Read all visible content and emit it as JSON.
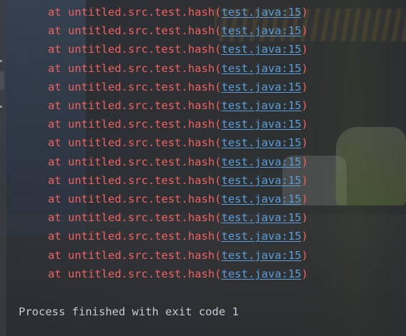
{
  "console": {
    "stack_lines": [
      {
        "prefix": "at untitled.src.test.hash(",
        "link": "test.java:15",
        "suffix": ")"
      },
      {
        "prefix": "at untitled.src.test.hash(",
        "link": "test.java:15",
        "suffix": ")"
      },
      {
        "prefix": "at untitled.src.test.hash(",
        "link": "test.java:15",
        "suffix": ")"
      },
      {
        "prefix": "at untitled.src.test.hash(",
        "link": "test.java:15",
        "suffix": ")"
      },
      {
        "prefix": "at untitled.src.test.hash(",
        "link": "test.java:15",
        "suffix": ")"
      },
      {
        "prefix": "at untitled.src.test.hash(",
        "link": "test.java:15",
        "suffix": ")"
      },
      {
        "prefix": "at untitled.src.test.hash(",
        "link": "test.java:15",
        "suffix": ")"
      },
      {
        "prefix": "at untitled.src.test.hash(",
        "link": "test.java:15",
        "suffix": ")"
      },
      {
        "prefix": "at untitled.src.test.hash(",
        "link": "test.java:15",
        "suffix": ")"
      },
      {
        "prefix": "at untitled.src.test.hash(",
        "link": "test.java:15",
        "suffix": ")"
      },
      {
        "prefix": "at untitled.src.test.hash(",
        "link": "test.java:15",
        "suffix": ")"
      },
      {
        "prefix": "at untitled.src.test.hash(",
        "link": "test.java:15",
        "suffix": ")"
      },
      {
        "prefix": "at untitled.src.test.hash(",
        "link": "test.java:15",
        "suffix": ")"
      },
      {
        "prefix": "at untitled.src.test.hash(",
        "link": "test.java:15",
        "suffix": ")"
      },
      {
        "prefix": "at untitled.src.test.hash(",
        "link": "test.java:15",
        "suffix": ")"
      }
    ],
    "exit_message": "Process finished with exit code 1"
  },
  "colors": {
    "error_text": "#f0615f",
    "link_text": "#5a9fdc",
    "normal_text": "#c9ccd1",
    "background": "#2b2d30"
  }
}
